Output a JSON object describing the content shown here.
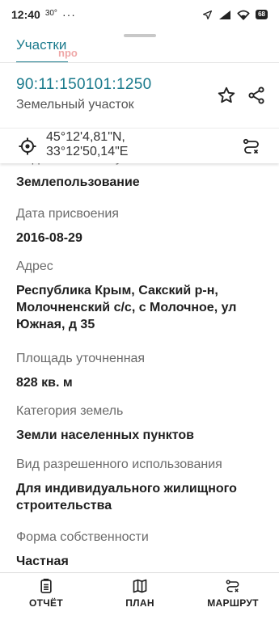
{
  "status_bar": {
    "time": "12:40",
    "temp": "30°",
    "dots": "···",
    "battery": "68"
  },
  "header": {
    "tab_label": "Участки",
    "watermark": "npo"
  },
  "parcel": {
    "cadastral_number": "90:11:150101:1250",
    "type": "Земельный участок",
    "lat": "45°12'4,81\"N,",
    "lon": "33°12'50,14\"E"
  },
  "fields": [
    {
      "label": "Вид земельного участка",
      "value": "Землепользование"
    },
    {
      "label": "Дата присвоения",
      "value": "2016-08-29"
    },
    {
      "label": "Адрес",
      "value": "Республика Крым, Сакский р-н, Молочненский с/с, с Молочное, ул Южная, д 35"
    },
    {
      "label": "Площадь уточненная",
      "value": "828 кв. м"
    },
    {
      "label": "Категория земель",
      "value": "Земли населенных пунктов"
    },
    {
      "label": "Вид разрешенного использования",
      "value": "Для индивидуального жилищного строительства"
    },
    {
      "label": "Форма собственности",
      "value": "Частная"
    }
  ],
  "bottom_nav": {
    "report": "ОТЧЁТ",
    "plan": "ПЛАН",
    "route": "МАРШРУТ"
  }
}
